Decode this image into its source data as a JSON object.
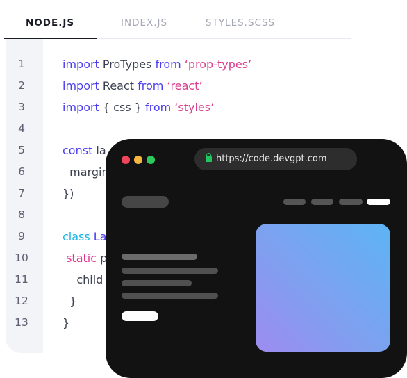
{
  "tabs": [
    {
      "label": "NODE.JS",
      "active": true
    },
    {
      "label": "INDEX.JS",
      "active": false
    },
    {
      "label": "STYLES.SCSS",
      "active": false
    }
  ],
  "editor": {
    "lines": [
      {
        "n": "1",
        "tokens": [
          {
            "t": "import",
            "c": "kw"
          },
          {
            "t": " ProTypes ",
            "c": ""
          },
          {
            "t": "from",
            "c": "kw"
          },
          {
            "t": " ‘prop-types’",
            "c": "str"
          }
        ]
      },
      {
        "n": "2",
        "tokens": [
          {
            "t": "import",
            "c": "kw"
          },
          {
            "t": " React ",
            "c": ""
          },
          {
            "t": "from",
            "c": "kw"
          },
          {
            "t": " ‘react’",
            "c": "str"
          }
        ]
      },
      {
        "n": "3",
        "tokens": [
          {
            "t": "import",
            "c": "kw"
          },
          {
            "t": " { css } ",
            "c": ""
          },
          {
            "t": "from",
            "c": "kw"
          },
          {
            "t": " ‘styles’",
            "c": "str"
          }
        ]
      },
      {
        "n": "4",
        "tokens": []
      },
      {
        "n": "5",
        "tokens": [
          {
            "t": "const",
            "c": "kw"
          },
          {
            "t": " la",
            "c": ""
          }
        ]
      },
      {
        "n": "6",
        "tokens": [
          {
            "t": "  margin",
            "c": ""
          }
        ]
      },
      {
        "n": "7",
        "tokens": [
          {
            "t": "})",
            "c": ""
          }
        ]
      },
      {
        "n": "8",
        "tokens": []
      },
      {
        "n": "9",
        "tokens": [
          {
            "t": "class",
            "c": "cls"
          },
          {
            "t": " La",
            "c": "kw"
          }
        ]
      },
      {
        "n": "10",
        "tokens": [
          {
            "t": " static",
            "c": "pink"
          },
          {
            "t": " p",
            "c": ""
          }
        ]
      },
      {
        "n": "11",
        "tokens": [
          {
            "t": "    child",
            "c": ""
          }
        ]
      },
      {
        "n": "12",
        "tokens": [
          {
            "t": "  }",
            "c": ""
          }
        ]
      },
      {
        "n": "13",
        "tokens": [
          {
            "t": "}",
            "c": ""
          }
        ]
      }
    ]
  },
  "browser": {
    "url": "https://code.devgpt.com",
    "traffic_lights": [
      "#f0465c",
      "#f5b53f",
      "#2ec95c"
    ],
    "nav_pill_colors": [
      "#555555",
      "#555555",
      "#555555",
      "#ffffff"
    ]
  }
}
